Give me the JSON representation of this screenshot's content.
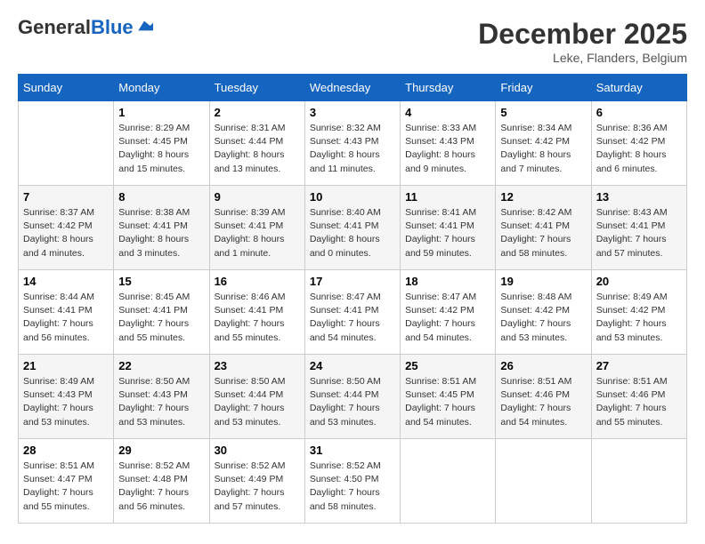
{
  "header": {
    "logo_general": "General",
    "logo_blue": "Blue",
    "month": "December 2025",
    "location": "Leke, Flanders, Belgium"
  },
  "days_of_week": [
    "Sunday",
    "Monday",
    "Tuesday",
    "Wednesday",
    "Thursday",
    "Friday",
    "Saturday"
  ],
  "weeks": [
    [
      {
        "day": "",
        "info": ""
      },
      {
        "day": "1",
        "info": "Sunrise: 8:29 AM\nSunset: 4:45 PM\nDaylight: 8 hours\nand 15 minutes."
      },
      {
        "day": "2",
        "info": "Sunrise: 8:31 AM\nSunset: 4:44 PM\nDaylight: 8 hours\nand 13 minutes."
      },
      {
        "day": "3",
        "info": "Sunrise: 8:32 AM\nSunset: 4:43 PM\nDaylight: 8 hours\nand 11 minutes."
      },
      {
        "day": "4",
        "info": "Sunrise: 8:33 AM\nSunset: 4:43 PM\nDaylight: 8 hours\nand 9 minutes."
      },
      {
        "day": "5",
        "info": "Sunrise: 8:34 AM\nSunset: 4:42 PM\nDaylight: 8 hours\nand 7 minutes."
      },
      {
        "day": "6",
        "info": "Sunrise: 8:36 AM\nSunset: 4:42 PM\nDaylight: 8 hours\nand 6 minutes."
      }
    ],
    [
      {
        "day": "7",
        "info": "Sunrise: 8:37 AM\nSunset: 4:42 PM\nDaylight: 8 hours\nand 4 minutes."
      },
      {
        "day": "8",
        "info": "Sunrise: 8:38 AM\nSunset: 4:41 PM\nDaylight: 8 hours\nand 3 minutes."
      },
      {
        "day": "9",
        "info": "Sunrise: 8:39 AM\nSunset: 4:41 PM\nDaylight: 8 hours\nand 1 minute."
      },
      {
        "day": "10",
        "info": "Sunrise: 8:40 AM\nSunset: 4:41 PM\nDaylight: 8 hours\nand 0 minutes."
      },
      {
        "day": "11",
        "info": "Sunrise: 8:41 AM\nSunset: 4:41 PM\nDaylight: 7 hours\nand 59 minutes."
      },
      {
        "day": "12",
        "info": "Sunrise: 8:42 AM\nSunset: 4:41 PM\nDaylight: 7 hours\nand 58 minutes."
      },
      {
        "day": "13",
        "info": "Sunrise: 8:43 AM\nSunset: 4:41 PM\nDaylight: 7 hours\nand 57 minutes."
      }
    ],
    [
      {
        "day": "14",
        "info": "Sunrise: 8:44 AM\nSunset: 4:41 PM\nDaylight: 7 hours\nand 56 minutes."
      },
      {
        "day": "15",
        "info": "Sunrise: 8:45 AM\nSunset: 4:41 PM\nDaylight: 7 hours\nand 55 minutes."
      },
      {
        "day": "16",
        "info": "Sunrise: 8:46 AM\nSunset: 4:41 PM\nDaylight: 7 hours\nand 55 minutes."
      },
      {
        "day": "17",
        "info": "Sunrise: 8:47 AM\nSunset: 4:41 PM\nDaylight: 7 hours\nand 54 minutes."
      },
      {
        "day": "18",
        "info": "Sunrise: 8:47 AM\nSunset: 4:42 PM\nDaylight: 7 hours\nand 54 minutes."
      },
      {
        "day": "19",
        "info": "Sunrise: 8:48 AM\nSunset: 4:42 PM\nDaylight: 7 hours\nand 53 minutes."
      },
      {
        "day": "20",
        "info": "Sunrise: 8:49 AM\nSunset: 4:42 PM\nDaylight: 7 hours\nand 53 minutes."
      }
    ],
    [
      {
        "day": "21",
        "info": "Sunrise: 8:49 AM\nSunset: 4:43 PM\nDaylight: 7 hours\nand 53 minutes."
      },
      {
        "day": "22",
        "info": "Sunrise: 8:50 AM\nSunset: 4:43 PM\nDaylight: 7 hours\nand 53 minutes."
      },
      {
        "day": "23",
        "info": "Sunrise: 8:50 AM\nSunset: 4:44 PM\nDaylight: 7 hours\nand 53 minutes."
      },
      {
        "day": "24",
        "info": "Sunrise: 8:50 AM\nSunset: 4:44 PM\nDaylight: 7 hours\nand 53 minutes."
      },
      {
        "day": "25",
        "info": "Sunrise: 8:51 AM\nSunset: 4:45 PM\nDaylight: 7 hours\nand 54 minutes."
      },
      {
        "day": "26",
        "info": "Sunrise: 8:51 AM\nSunset: 4:46 PM\nDaylight: 7 hours\nand 54 minutes."
      },
      {
        "day": "27",
        "info": "Sunrise: 8:51 AM\nSunset: 4:46 PM\nDaylight: 7 hours\nand 55 minutes."
      }
    ],
    [
      {
        "day": "28",
        "info": "Sunrise: 8:51 AM\nSunset: 4:47 PM\nDaylight: 7 hours\nand 55 minutes."
      },
      {
        "day": "29",
        "info": "Sunrise: 8:52 AM\nSunset: 4:48 PM\nDaylight: 7 hours\nand 56 minutes."
      },
      {
        "day": "30",
        "info": "Sunrise: 8:52 AM\nSunset: 4:49 PM\nDaylight: 7 hours\nand 57 minutes."
      },
      {
        "day": "31",
        "info": "Sunrise: 8:52 AM\nSunset: 4:50 PM\nDaylight: 7 hours\nand 58 minutes."
      },
      {
        "day": "",
        "info": ""
      },
      {
        "day": "",
        "info": ""
      },
      {
        "day": "",
        "info": ""
      }
    ]
  ]
}
